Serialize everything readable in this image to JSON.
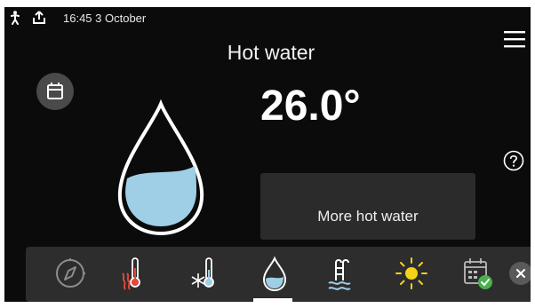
{
  "status_bar": {
    "time_date": "16:45 3  October",
    "icons": [
      "person-icon",
      "upload-icon"
    ]
  },
  "header": {
    "title": "Hot water"
  },
  "main": {
    "temperature": "26.0°",
    "more_hot_water_label": "More hot water"
  },
  "nav_bar": {
    "items": [
      "compass-icon",
      "heating-icon",
      "cooling-icon",
      "hot-water-icon",
      "pool-icon",
      "solar-icon",
      "schedule-icon"
    ],
    "active": "hot-water-icon"
  },
  "colors": {
    "background": "#0b0b0b",
    "water": "#9fcfe6",
    "heating_red": "#e2473a",
    "solar_yellow": "#f4d21a",
    "schedule_green": "#4caf50"
  }
}
